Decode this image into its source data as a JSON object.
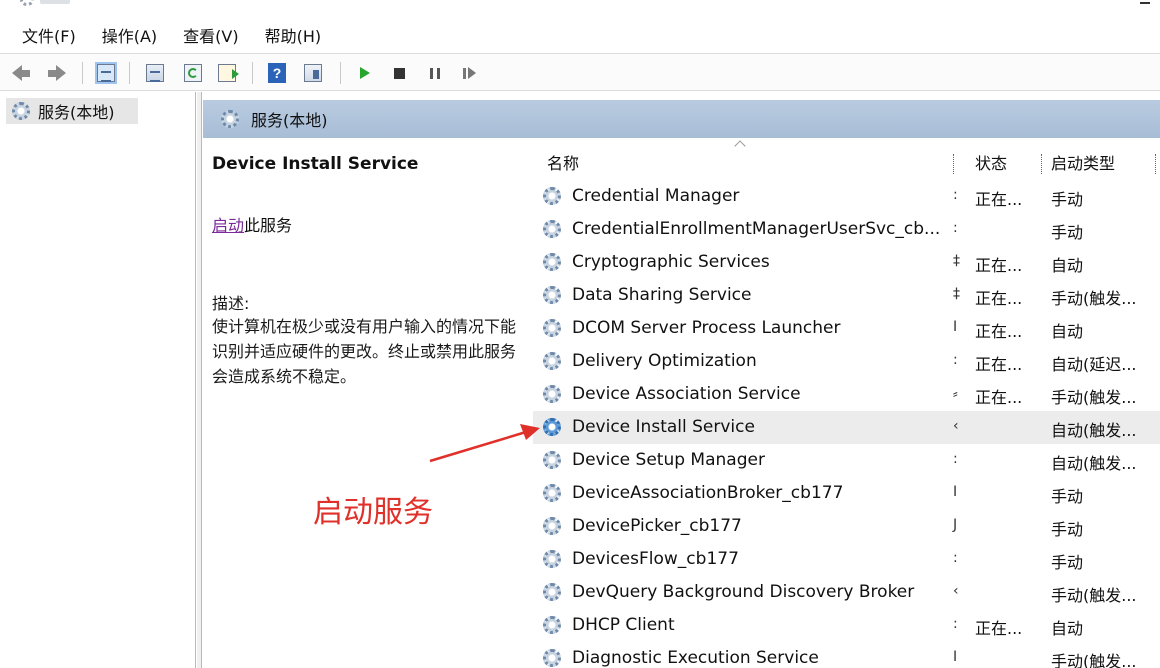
{
  "menu": {
    "file": "文件(F)",
    "action": "操作(A)",
    "view": "查看(V)",
    "help": "帮助(H)"
  },
  "tree": {
    "root_label": "服务(本地)"
  },
  "panel": {
    "header_label": "服务(本地)"
  },
  "details": {
    "service_title": "Device Install Service",
    "start_link": "启动",
    "start_suffix": "此服务",
    "description_label": "描述:",
    "description_text": "使计算机在极少或没有用户输入的情况下能识别并适应硬件的更改。终止或禁用此服务会造成系统不稳定。"
  },
  "columns": {
    "name": "名称",
    "status": "状态",
    "startup_type": "启动类型"
  },
  "rows": [
    {
      "name": "Credential Manager",
      "desc": ":",
      "status": "正在...",
      "startup": "手动"
    },
    {
      "name": "CredentialEnrollmentManagerUserSvc_cb...",
      "desc": ":",
      "status": "",
      "startup": "手动"
    },
    {
      "name": "Cryptographic Services",
      "desc": "‡",
      "status": "正在...",
      "startup": "自动"
    },
    {
      "name": "Data Sharing Service",
      "desc": "‡",
      "status": "正在...",
      "startup": "手动(触发..."
    },
    {
      "name": "DCOM Server Process Launcher",
      "desc": "I",
      "status": "正在...",
      "startup": "自动"
    },
    {
      "name": "Delivery Optimization",
      "desc": ":",
      "status": "正在...",
      "startup": "自动(延迟..."
    },
    {
      "name": "Device Association Service",
      "desc": "⸗",
      "status": "正在...",
      "startup": "手动(触发..."
    },
    {
      "name": "Device Install Service",
      "desc": "‹",
      "status": "",
      "startup": "自动(触发..."
    },
    {
      "name": "Device Setup Manager",
      "desc": ":",
      "status": "",
      "startup": "自动(触发..."
    },
    {
      "name": "DeviceAssociationBroker_cb177",
      "desc": "I",
      "status": "",
      "startup": "手动"
    },
    {
      "name": "DevicePicker_cb177",
      "desc": "J",
      "status": "",
      "startup": "手动"
    },
    {
      "name": "DevicesFlow_cb177",
      "desc": ":",
      "status": "",
      "startup": "手动"
    },
    {
      "name": "DevQuery Background Discovery Broker",
      "desc": "‹",
      "status": "",
      "startup": "手动(触发..."
    },
    {
      "name": "DHCP Client",
      "desc": ":",
      "status": "正在...",
      "startup": "自动"
    },
    {
      "name": "Diagnostic Execution Service",
      "desc": "I",
      "status": "",
      "startup": "手动(触发..."
    }
  ],
  "annotation": {
    "text": "启动服务",
    "color": "#e0302a"
  },
  "toolbar_icons": [
    "back-icon",
    "forward-icon",
    "show-hide-tree-icon",
    "properties-sheet-icon",
    "refresh-icon",
    "export-list-icon",
    "help-icon",
    "show-console-icon",
    "start-service-icon",
    "stop-service-icon",
    "pause-service-icon",
    "resume-service-icon"
  ]
}
